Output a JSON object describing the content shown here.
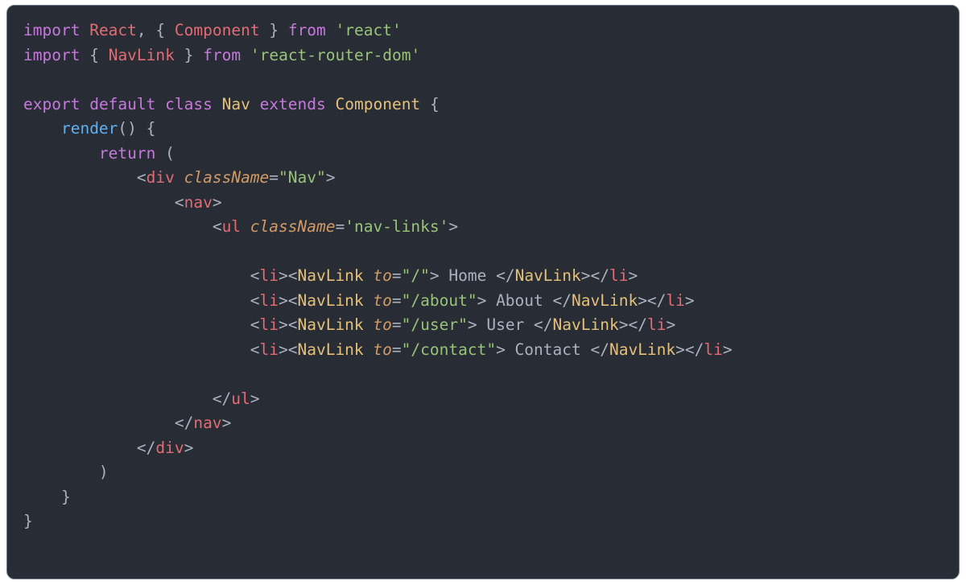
{
  "code": {
    "line1": {
      "import": "import",
      "react": "React",
      "comma": ",",
      "lbrace": "{",
      "component": "Component",
      "rbrace": "}",
      "from": "from",
      "pkg": "'react'"
    },
    "line2": {
      "import": "import",
      "lbrace": "{",
      "navlink": "NavLink",
      "rbrace": "}",
      "from": "from",
      "pkg": "'react-router-dom'"
    },
    "line4": {
      "export": "export",
      "default": "default",
      "class": "class",
      "name": "Nav",
      "extends": "extends",
      "base": "Component",
      "lbrace": "{"
    },
    "line5": {
      "render": "render",
      "parens": "()",
      "lbrace": "{"
    },
    "line6": {
      "return": "return",
      "lparen": "("
    },
    "line7": {
      "lt": "<",
      "tag": "div",
      "sp": " ",
      "attr": "className",
      "eq": "=",
      "val": "\"Nav\"",
      "gt": ">"
    },
    "line8": {
      "lt": "<",
      "tag": "nav",
      "gt": ">"
    },
    "line9": {
      "lt": "<",
      "tag": "ul",
      "sp": " ",
      "attr": "className",
      "eq": "=",
      "val": "'nav-links'",
      "gt": ">"
    },
    "items": [
      {
        "lt1": "<",
        "li": "li",
        "gt1": "><",
        "nl": "NavLink",
        "sp": " ",
        "to": "to",
        "eq": "=",
        "path": "\"/\"",
        "gt2": ">",
        "text": " Home ",
        "lt2": "</",
        "nl2": "NavLink",
        "gt3": "></",
        "li2": "li",
        "gt4": ">"
      },
      {
        "lt1": "<",
        "li": "li",
        "gt1": "><",
        "nl": "NavLink",
        "sp": " ",
        "to": "to",
        "eq": "=",
        "path": "\"/about\"",
        "gt2": ">",
        "text": " About ",
        "lt2": "</",
        "nl2": "NavLink",
        "gt3": "></",
        "li2": "li",
        "gt4": ">"
      },
      {
        "lt1": "<",
        "li": "li",
        "gt1": "><",
        "nl": "NavLink",
        "sp": " ",
        "to": "to",
        "eq": "=",
        "path": "\"/user\"",
        "gt2": ">",
        "text": " User ",
        "lt2": "</",
        "nl2": "NavLink",
        "gt3": "></",
        "li2": "li",
        "gt4": ">"
      },
      {
        "lt1": "<",
        "li": "li",
        "gt1": "><",
        "nl": "NavLink",
        "sp": " ",
        "to": "to",
        "eq": "=",
        "path": "\"/contact\"",
        "gt2": ">",
        "text": " Contact ",
        "lt2": "</",
        "nl2": "NavLink",
        "gt3": "></",
        "li2": "li",
        "gt4": ">"
      }
    ],
    "close_ul": {
      "lt": "</",
      "tag": "ul",
      "gt": ">"
    },
    "close_nav": {
      "lt": "</",
      "tag": "nav",
      "gt": ">"
    },
    "close_div": {
      "lt": "</",
      "tag": "div",
      "gt": ">"
    },
    "line_rparen": ")",
    "line_rbrace1": "}",
    "line_rbrace2": "}"
  }
}
